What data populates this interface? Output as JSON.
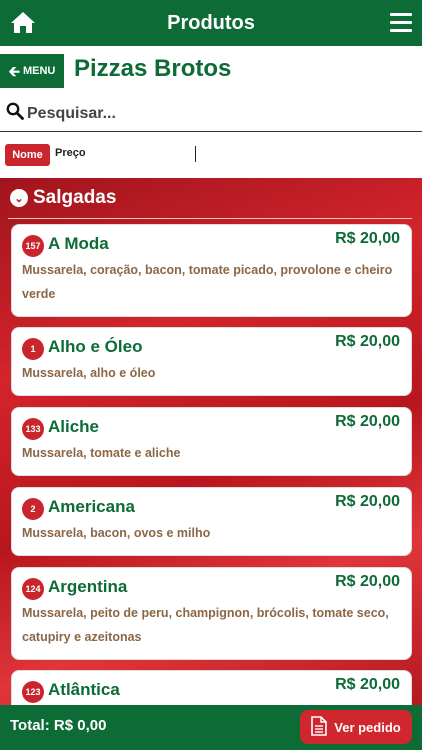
{
  "header": {
    "title": "Produtos",
    "home_icon": "home-icon",
    "menu_icon": "hamburger-menu-icon"
  },
  "subheader": {
    "back_label": "MENU",
    "page_title": "Pizzas Brotos"
  },
  "search": {
    "placeholder": "Pesquisar..."
  },
  "sort": {
    "nome": "Nome",
    "preco": "Preço",
    "active": "nome"
  },
  "section": {
    "title": "Salgadas"
  },
  "products": [
    {
      "code": "157",
      "name": "A Moda",
      "price": "R$ 20,00",
      "desc": "Mussarela, coração, bacon, tomate picado, provolone e cheiro verde"
    },
    {
      "code": "1",
      "name": "Alho e Óleo",
      "price": "R$ 20,00",
      "desc": "Mussarela, alho e óleo"
    },
    {
      "code": "133",
      "name": "Aliche",
      "price": "R$ 20,00",
      "desc": "Mussarela, tomate e aliche"
    },
    {
      "code": "2",
      "name": "Americana",
      "price": "R$ 20,00",
      "desc": "Mussarela, bacon, ovos e milho"
    },
    {
      "code": "124",
      "name": "Argentina",
      "price": "R$ 20,00",
      "desc": "Mussarela, peito de peru, champignon, brócolis, tomate seco, catupiry e azeitonas"
    },
    {
      "code": "123",
      "name": "Atlântica",
      "price": "R$ 20,00",
      "desc": ""
    }
  ],
  "footer": {
    "total": "Total: R$ 0,00",
    "order_label": "Ver pedido"
  },
  "colors": {
    "brand_green": "#0d6b35",
    "accent_red": "#c8262c",
    "desc_brown": "#8a6748"
  }
}
